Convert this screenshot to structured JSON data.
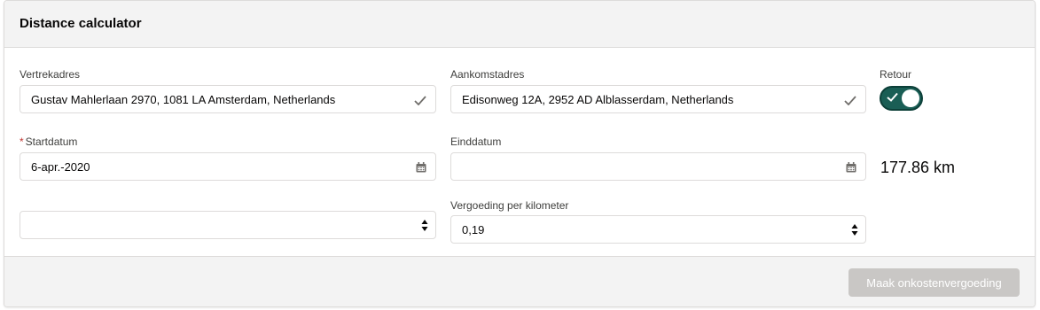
{
  "card": {
    "title": "Distance calculator"
  },
  "form": {
    "departure": {
      "label": "Vertrekadres",
      "value": "Gustav Mahlerlaan 2970, 1081 LA Amsterdam, Netherlands"
    },
    "arrival": {
      "label": "Aankomstadres",
      "value": "Edisonweg 12A, 2952 AD Alblasserdam, Netherlands"
    },
    "return": {
      "label": "Retour",
      "checked": true
    },
    "start_date": {
      "required_marker": "*",
      "label": "Startdatum",
      "value": "6-apr.-2020"
    },
    "end_date": {
      "label": "Einddatum",
      "value": ""
    },
    "number_unlabeled": {
      "value": ""
    },
    "rate": {
      "label": "Vergoeding per kilometer",
      "value": "0,19"
    },
    "distance": "177.86 km"
  },
  "footer": {
    "submit_label": "Maak onkostenvergoeding",
    "submit_enabled": false
  },
  "icons": {
    "check": "check-icon",
    "calendar": "calendar-icon",
    "stepper": "stepper-icon",
    "toggle_check": "toggle-check-icon"
  },
  "colors": {
    "toggle_on": "#1a5e55",
    "button_disabled": "#c9c7c5",
    "header_bg": "#f3f3f3",
    "required": "#c23934"
  }
}
